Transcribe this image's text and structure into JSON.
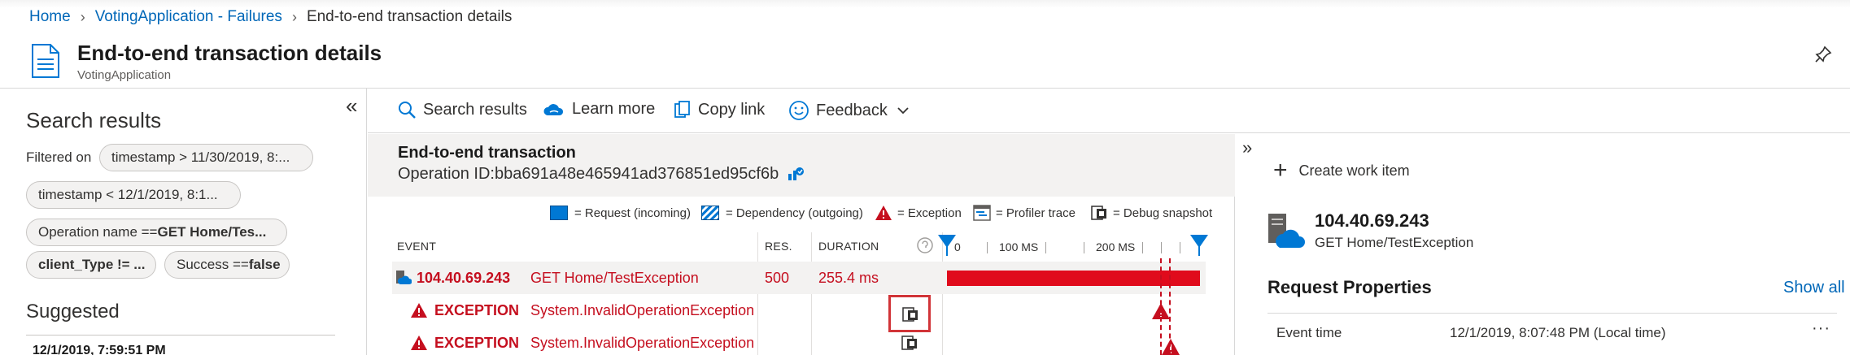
{
  "breadcrumb": {
    "home": "Home",
    "app": "VotingApplication - Failures",
    "current": "End-to-end transaction details",
    "separator": ">"
  },
  "header": {
    "title": "End-to-end transaction details",
    "subtitle": "VotingApplication",
    "icon": "document-icon",
    "pin_icon": "pin-icon"
  },
  "left_panel": {
    "collapse": "«",
    "title": "Search results",
    "filtered_on": "Filtered on",
    "filters": [
      {
        "text": "timestamp > 11/30/2019, 8:..."
      },
      {
        "text": "timestamp < 12/1/2019, 8:1..."
      },
      {
        "prefix": "Operation name == ",
        "value": "GET Home/Tes..."
      },
      {
        "prefix": "",
        "value": "client_Type != ..."
      },
      {
        "prefix": "Success == ",
        "value": "false"
      }
    ],
    "suggested": "Suggested",
    "suggested_item": "12/1/2019, 7:59:51 PM"
  },
  "toolbar": {
    "search_results": "Search results",
    "learn_more": "Learn more",
    "copy_link": "Copy link",
    "feedback": "Feedback"
  },
  "transaction": {
    "title": "End-to-end transaction",
    "operation_id_label": "Operation ID: ",
    "operation_id": "bba691a48e465941ad376851ed95cf6b",
    "legend": [
      {
        "label": "= Request (incoming)",
        "icon": "request-swatch"
      },
      {
        "label": "= Dependency (outgoing)",
        "icon": "dependency-swatch"
      },
      {
        "label": "= Exception",
        "icon": "exception-icon"
      },
      {
        "label": "= Profiler trace",
        "icon": "profiler-trace-icon"
      },
      {
        "label": "= Debug snapshot",
        "icon": "debug-snapshot-icon"
      }
    ],
    "columns": {
      "event": "EVENT",
      "res": "RES.",
      "duration": "DURATION"
    },
    "timeline_ticks": [
      "0",
      "100 MS",
      "200 MS"
    ],
    "rows": [
      {
        "event": "104.40.69.243",
        "name": "GET Home/TestException",
        "res": "500",
        "duration": "255.4 ms",
        "bar_fraction": 1.0
      },
      {
        "event": "EXCEPTION",
        "name": "System.InvalidOperationException"
      },
      {
        "event": "EXCEPTION",
        "name": "System.InvalidOperationException"
      }
    ]
  },
  "details": {
    "expand": "»",
    "create_work_item": "Create work item",
    "ip": "104.40.69.243",
    "route": "GET Home/TestException",
    "request_properties": "Request Properties",
    "show_all": "Show all",
    "event_time_label": "Event time",
    "event_time_value": "12/1/2019, 8:07:48 PM (Local time)",
    "more": "···"
  },
  "colors": {
    "link": "#0067b8",
    "error": "#c50f1f",
    "bar": "#e00b1c",
    "request": "#0078d4",
    "highlight_box": "#d13438"
  }
}
